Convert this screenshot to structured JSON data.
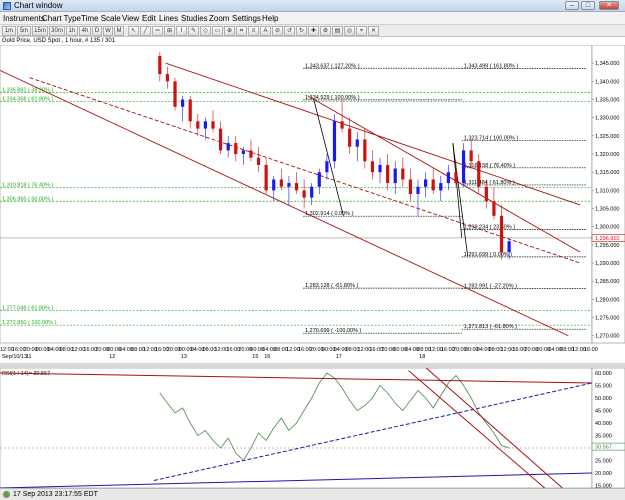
{
  "window": {
    "title": "Chart window",
    "min": "–",
    "max": "□",
    "close": "✕"
  },
  "menu": [
    "Instruments",
    "Chart Type",
    "Time Scale",
    "View",
    "Edit",
    "Lines",
    "Studies",
    "Zoom",
    "Settings",
    "Help"
  ],
  "toolbar": [
    "1m",
    "5m",
    "15m",
    "30m",
    "1h",
    "4h",
    "D",
    "W",
    "M"
  ],
  "symbol_line": "Gold Price, USD Spot , 1 hour, # 135 / 301",
  "status": {
    "text": "17 Sep 2013 23:17:55 EDT"
  },
  "colors": {
    "up": "#1a1aee",
    "down": "#cc1111",
    "fib_black": "#000000",
    "fib_green": "#22aa22",
    "channel": "#aa1111",
    "rsi_line": "#4a8a4a",
    "trend_blue": "#1a1aaa"
  },
  "chart_data": [
    {
      "type": "candlestick",
      "y_axis_labels": [
        "1,345.000",
        "1,340.000",
        "1,335.000",
        "1,330.000",
        "1,325.000",
        "1,320.000",
        "1,315.000",
        "1,310.000",
        "1,305.000",
        "1,300.000",
        "1,295.000",
        "1,290.000",
        "1,285.000",
        "1,280.000",
        "1,275.000",
        "1,270.000"
      ],
      "ylim": [
        1268,
        1350
      ],
      "current_price": "1,296.910",
      "x_time_labels": [
        "12:00",
        "16:00",
        "20:00",
        "00:00",
        "04:00",
        "08:00",
        "12:00",
        "16:00",
        "20:00",
        "00:00",
        "04:00",
        "08:00",
        "12:00",
        "16:00",
        "20:00",
        "00:00",
        "04:00",
        "08:00",
        "12:00",
        "16:00",
        "20:00",
        "00:00",
        "04:00",
        "08:00",
        "12:00",
        "16:00",
        "20:00",
        "00:00",
        "04:00",
        "08:00",
        "12:00",
        "16:00",
        "20:00",
        "00:00",
        "04:00",
        "08:00",
        "12:00",
        "16:00",
        "20:00",
        "00:00",
        "04:00",
        "08:00",
        "12:00",
        "16:00",
        "20:00",
        "00:00",
        "04:00",
        "08:00",
        "12:00",
        "16:00"
      ],
      "x_day_labels": [
        {
          "label": "Sep/10/13",
          "index": 0
        },
        {
          "label": "11",
          "index": 2
        },
        {
          "label": "12",
          "index": 9
        },
        {
          "label": "13",
          "index": 15
        },
        {
          "label": "15",
          "index": 21
        },
        {
          "label": "16",
          "index": 22
        },
        {
          "label": "17",
          "index": 28
        },
        {
          "label": "18",
          "index": 35
        }
      ],
      "fib_labels_black": [
        {
          "text": "1,343.637 ( 127.20% )",
          "price": 1343.6,
          "x0": 0.512,
          "x1": 0.78
        },
        {
          "text": "1,343.499 ( 161.80% )",
          "price": 1343.5,
          "x0": 0.78,
          "x1": 0.99
        },
        {
          "text": "1,334.929 ( 100.00% )",
          "price": 1334.9,
          "x0": 0.512,
          "x1": 0.78
        },
        {
          "text": "1,323.714 ( 100.00% )",
          "price": 1323.7,
          "x0": 0.78,
          "x1": 0.99
        },
        {
          "text": "1,316.158 ( 76.40% )",
          "price": 1316.2,
          "x0": 0.78,
          "x1": 0.99
        },
        {
          "text": "1,311.484 ( 61.80% )",
          "price": 1311.5,
          "x0": 0.78,
          "x1": 0.99
        },
        {
          "text": "1,302.914 ( 0.00% )",
          "price": 1302.9,
          "x0": 0.512,
          "x1": 0.78
        },
        {
          "text": "1,299.234 ( 23.60% )",
          "price": 1299.2,
          "x0": 0.78,
          "x1": 0.99
        },
        {
          "text": "1,291.699 ( 0.00% )",
          "price": 1291.7,
          "x0": 0.78,
          "x1": 0.99
        },
        {
          "text": "1,283.128 ( -61.80% )",
          "price": 1283.1,
          "x0": 0.512,
          "x1": 0.78
        },
        {
          "text": "1,282.991 ( -27.20% )",
          "price": 1283.0,
          "x0": 0.78,
          "x1": 0.99
        },
        {
          "text": "1,270.699 ( -100.00% )",
          "price": 1270.7,
          "x0": 0.512,
          "x1": 0.78
        },
        {
          "text": "1,271.813 ( -61.80% )",
          "price": 1271.8,
          "x0": 0.78,
          "x1": 0.99
        }
      ],
      "fib_labels_green": [
        {
          "text": "1,336.882 ( 38.20% )",
          "price": 1336.9
        },
        {
          "text": "1,334.368 ( 61.80% )",
          "price": 1334.4
        },
        {
          "text": "1,310.818 ( 76.40% )",
          "price": 1310.8
        },
        {
          "text": "1,306.965 ( 50.00% )",
          "price": 1307.0
        },
        {
          "text": "1,277.048 ( 61.80% )",
          "price": 1277.0
        },
        {
          "text": "1,272.850 ( 100.00% )",
          "price": 1272.9
        }
      ],
      "channels": [
        {
          "x0": 0.0,
          "p0": 1343,
          "x1": 0.96,
          "p1": 1270,
          "style": "solid"
        },
        {
          "x0": 0.05,
          "p0": 1341,
          "x1": 0.98,
          "p1": 1290,
          "style": "dashed"
        },
        {
          "x0": 0.52,
          "p0": 1336,
          "x1": 0.98,
          "p1": 1293,
          "style": "solid"
        },
        {
          "x0": 0.28,
          "p0": 1345,
          "x1": 0.98,
          "p1": 1306,
          "style": "solid"
        }
      ],
      "wave_lines": [
        {
          "x0": 0.53,
          "p0": 1335,
          "x1": 0.58,
          "p1": 1303
        },
        {
          "x0": 0.765,
          "p0": 1323,
          "x1": 0.79,
          "p1": 1292
        },
        {
          "x0": 0.765,
          "p0": 1323,
          "x1": 0.78,
          "p1": 1297
        }
      ],
      "candles": [
        [
          1347,
          1348,
          1340,
          1342
        ],
        [
          1342,
          1344,
          1338,
          1340
        ],
        [
          1340,
          1341,
          1332,
          1333
        ],
        [
          1333,
          1336,
          1329,
          1335
        ],
        [
          1335,
          1336,
          1327,
          1329
        ],
        [
          1329,
          1331,
          1325,
          1327
        ],
        [
          1327,
          1330,
          1324,
          1329
        ],
        [
          1329,
          1332,
          1326,
          1327
        ],
        [
          1327,
          1329,
          1320,
          1321
        ],
        [
          1321,
          1325,
          1319,
          1323
        ],
        [
          1323,
          1325,
          1318,
          1320
        ],
        [
          1320,
          1322,
          1317,
          1321
        ],
        [
          1321,
          1324,
          1318,
          1319
        ],
        [
          1319,
          1322,
          1315,
          1317
        ],
        [
          1317,
          1319,
          1309,
          1310
        ],
        [
          1310,
          1314,
          1307,
          1313
        ],
        [
          1313,
          1316,
          1310,
          1311
        ],
        [
          1311,
          1314,
          1306,
          1312
        ],
        [
          1312,
          1315,
          1309,
          1310
        ],
        [
          1310,
          1313,
          1305,
          1308
        ],
        [
          1308,
          1312,
          1306,
          1311
        ],
        [
          1311,
          1316,
          1309,
          1315
        ],
        [
          1315,
          1320,
          1313,
          1318
        ],
        [
          1318,
          1331,
          1316,
          1329
        ],
        [
          1329,
          1335,
          1326,
          1327
        ],
        [
          1327,
          1330,
          1320,
          1322
        ],
        [
          1322,
          1326,
          1318,
          1324
        ],
        [
          1324,
          1327,
          1316,
          1318
        ],
        [
          1318,
          1321,
          1313,
          1315
        ],
        [
          1315,
          1319,
          1312,
          1317
        ],
        [
          1317,
          1320,
          1310,
          1312
        ],
        [
          1312,
          1318,
          1309,
          1316
        ],
        [
          1316,
          1319,
          1311,
          1313
        ],
        [
          1313,
          1316,
          1307,
          1309
        ],
        [
          1309,
          1313,
          1303,
          1311
        ],
        [
          1311,
          1315,
          1308,
          1313
        ],
        [
          1313,
          1316,
          1309,
          1310
        ],
        [
          1310,
          1314,
          1307,
          1312
        ],
        [
          1312,
          1317,
          1310,
          1315
        ],
        [
          1315,
          1318,
          1311,
          1312
        ],
        [
          1312,
          1323,
          1311,
          1321
        ],
        [
          1321,
          1324,
          1316,
          1318
        ],
        [
          1318,
          1320,
          1309,
          1311
        ],
        [
          1311,
          1313,
          1305,
          1307
        ],
        [
          1307,
          1311,
          1302,
          1303
        ],
        [
          1303,
          1306,
          1291,
          1293
        ],
        [
          1293,
          1297,
          1291,
          1296
        ]
      ]
    },
    {
      "type": "line",
      "title": "RSI(1 / 14)= 30.567",
      "y_axis_labels": [
        "60.000",
        "55.000",
        "50.000",
        "45.000",
        "40.000",
        "35.000",
        "30.000",
        "25.000",
        "20.000",
        "15.000"
      ],
      "ylim": [
        14,
        62
      ],
      "current_value": "30.567",
      "values": [
        52,
        48,
        44,
        46,
        40,
        35,
        37,
        33,
        30,
        34,
        28,
        25,
        30,
        36,
        33,
        38,
        42,
        37,
        40,
        45,
        50,
        56,
        60,
        58,
        54,
        49,
        45,
        47,
        50,
        55,
        52,
        48,
        45,
        49,
        53,
        50,
        46,
        51,
        56,
        59,
        55,
        50,
        44,
        40,
        36,
        31,
        30
      ],
      "trendlines": [
        {
          "x0": 0.0,
          "v0": 60,
          "x1": 1.0,
          "v1": 56,
          "color": "#aa1111",
          "style": "solid"
        },
        {
          "x0": 0.26,
          "v0": 17,
          "x1": 1.0,
          "v1": 56,
          "color": "#1a1aaa",
          "style": "dashed"
        },
        {
          "x0": 0.0,
          "v0": 14,
          "x1": 1.0,
          "v1": 20,
          "color": "#1a1aaa",
          "style": "solid"
        },
        {
          "x0": 0.69,
          "v0": 61,
          "x1": 0.92,
          "v1": 14,
          "color": "#aa1111",
          "style": "solid"
        },
        {
          "x0": 0.72,
          "v0": 62,
          "x1": 0.95,
          "v1": 14,
          "color": "#aa1111",
          "style": "solid"
        }
      ]
    }
  ]
}
